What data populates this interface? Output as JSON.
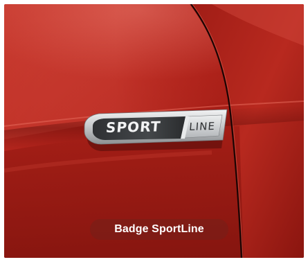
{
  "badge": {
    "word_sport": "SPORT",
    "word_line": "LINE"
  },
  "caption": {
    "text": "Badge SportLine"
  },
  "colors": {
    "paint_base": "#b3231b",
    "paint_highlight": "#d9463a",
    "paint_shadow": "#6a0f0b",
    "badge_dark": "#3a3c3f",
    "badge_chrome": "#d7d9db",
    "caption_bg": "#7a1f18"
  }
}
